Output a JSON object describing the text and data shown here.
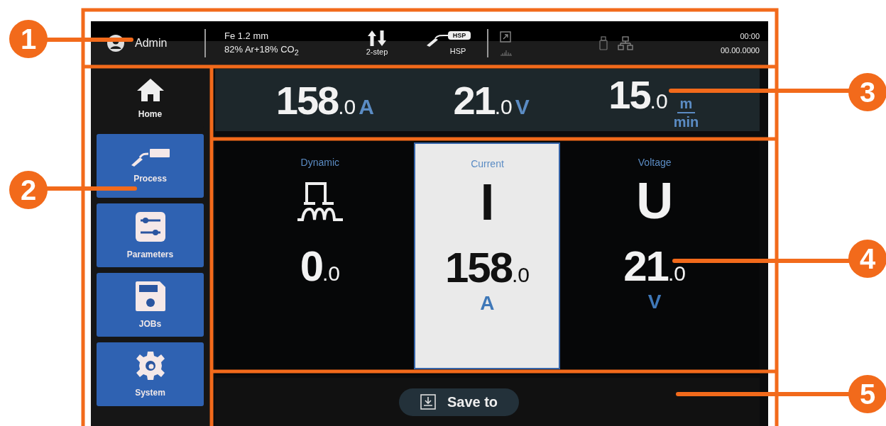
{
  "top_bar": {
    "user": "Admin",
    "material": "Fe 1.2 mm",
    "gas": "82% Ar+18% CO$_{2}$",
    "mode": "2-step",
    "torch_badge": "HSP",
    "torch": "HSP",
    "time": "00:00",
    "date": "00.00.0000"
  },
  "sidebar": {
    "items": [
      {
        "label": "Home",
        "kind": "home",
        "selected": true
      },
      {
        "label": "Process",
        "kind": "process",
        "selected": false
      },
      {
        "label": "Parameters",
        "kind": "parameters",
        "selected": false
      },
      {
        "label": "JOBs",
        "kind": "jobs",
        "selected": false
      },
      {
        "label": "System",
        "kind": "system",
        "selected": false
      }
    ]
  },
  "readouts": [
    {
      "whole": "158",
      "decimal": ".0",
      "unit": "A"
    },
    {
      "whole": "21",
      "decimal": ".0",
      "unit": "V"
    },
    {
      "whole": "15",
      "decimal": ".0",
      "unit_top": "m",
      "unit_bottom": "min"
    }
  ],
  "parameters": [
    {
      "label": "Dynamic",
      "kind": "icon",
      "whole": "0",
      "decimal": ".0",
      "selected": false
    },
    {
      "label": "Current",
      "kind": "symbol",
      "symbol": "I",
      "whole": "158",
      "decimal": ".0",
      "unit": "A",
      "selected": true
    },
    {
      "label": "Voltage",
      "kind": "symbol",
      "symbol": "U",
      "whole": "21",
      "decimal": ".0",
      "unit": "V",
      "selected": false
    }
  ],
  "save_button": "Save to",
  "callouts": [
    "1",
    "2",
    "3",
    "4",
    "5"
  ]
}
